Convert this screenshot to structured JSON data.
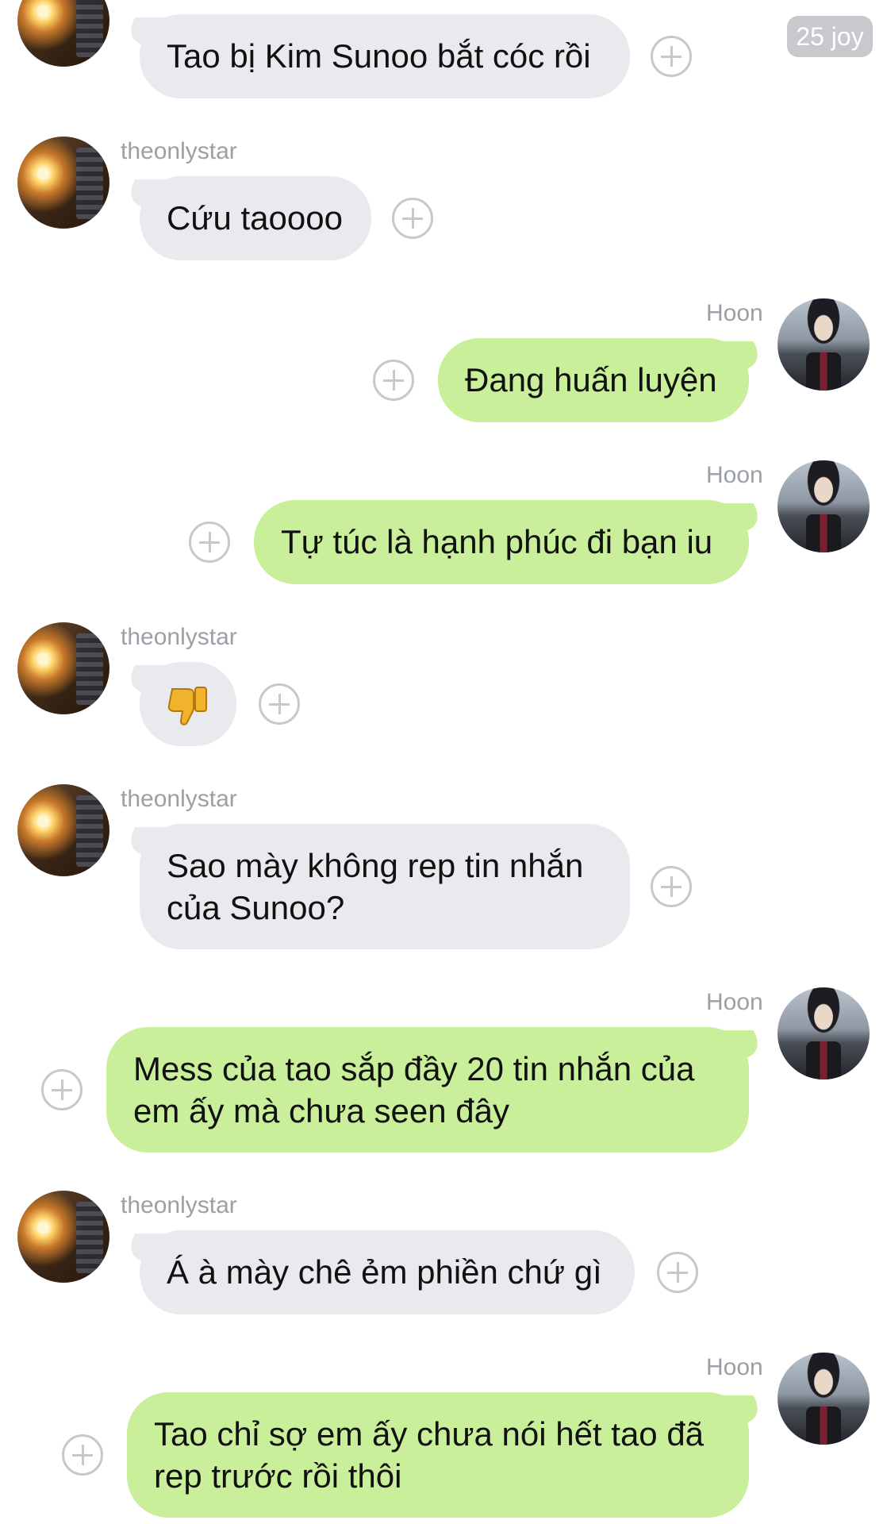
{
  "badge": "25 joy",
  "messages": [
    {
      "sender": "",
      "avatar": "theonlystar-avatar",
      "text": "Tao bị Kim Sunoo bắt cóc rồi",
      "direction": "in"
    },
    {
      "sender": "theonlystar",
      "text": "Cứu taoooo",
      "direction": "in"
    },
    {
      "sender": "Hoon",
      "text": "Đang huấn luyện",
      "direction": "out"
    },
    {
      "sender": "Hoon",
      "text": "Tự túc là hạnh phúc đi bạn iu",
      "direction": "out"
    },
    {
      "sender": "theonlystar",
      "text": "",
      "emoji": "thumbs-down",
      "direction": "in"
    },
    {
      "sender": "theonlystar",
      "text_line1": "Sao mày không rep tin nhắn",
      "text_line2": "của Sunoo?",
      "direction": "in"
    },
    {
      "sender": "Hoon",
      "text_line1": "Mess của tao sắp đầy 20 tin nhắn của",
      "text_line2": "em ấy mà chưa seen đây",
      "direction": "out"
    },
    {
      "sender": "theonlystar",
      "text": "Á à mày chê ẻm phiền chứ gì",
      "direction": "in"
    },
    {
      "sender": "Hoon",
      "text_line1": "Tao chỉ sợ em ấy chưa nói hết tao đã",
      "text_line2": "rep trước rồi thôi",
      "direction": "out"
    }
  ],
  "colors": {
    "incoming_bubble": "#e8eaed",
    "outgoing_bubble": "#c9ef9a",
    "sender_name": "#9aa0a6",
    "add_reaction": "#c5c8cc"
  },
  "icons": [
    "add-reaction-icon",
    "thumbs-down-emoji",
    "avatar"
  ]
}
